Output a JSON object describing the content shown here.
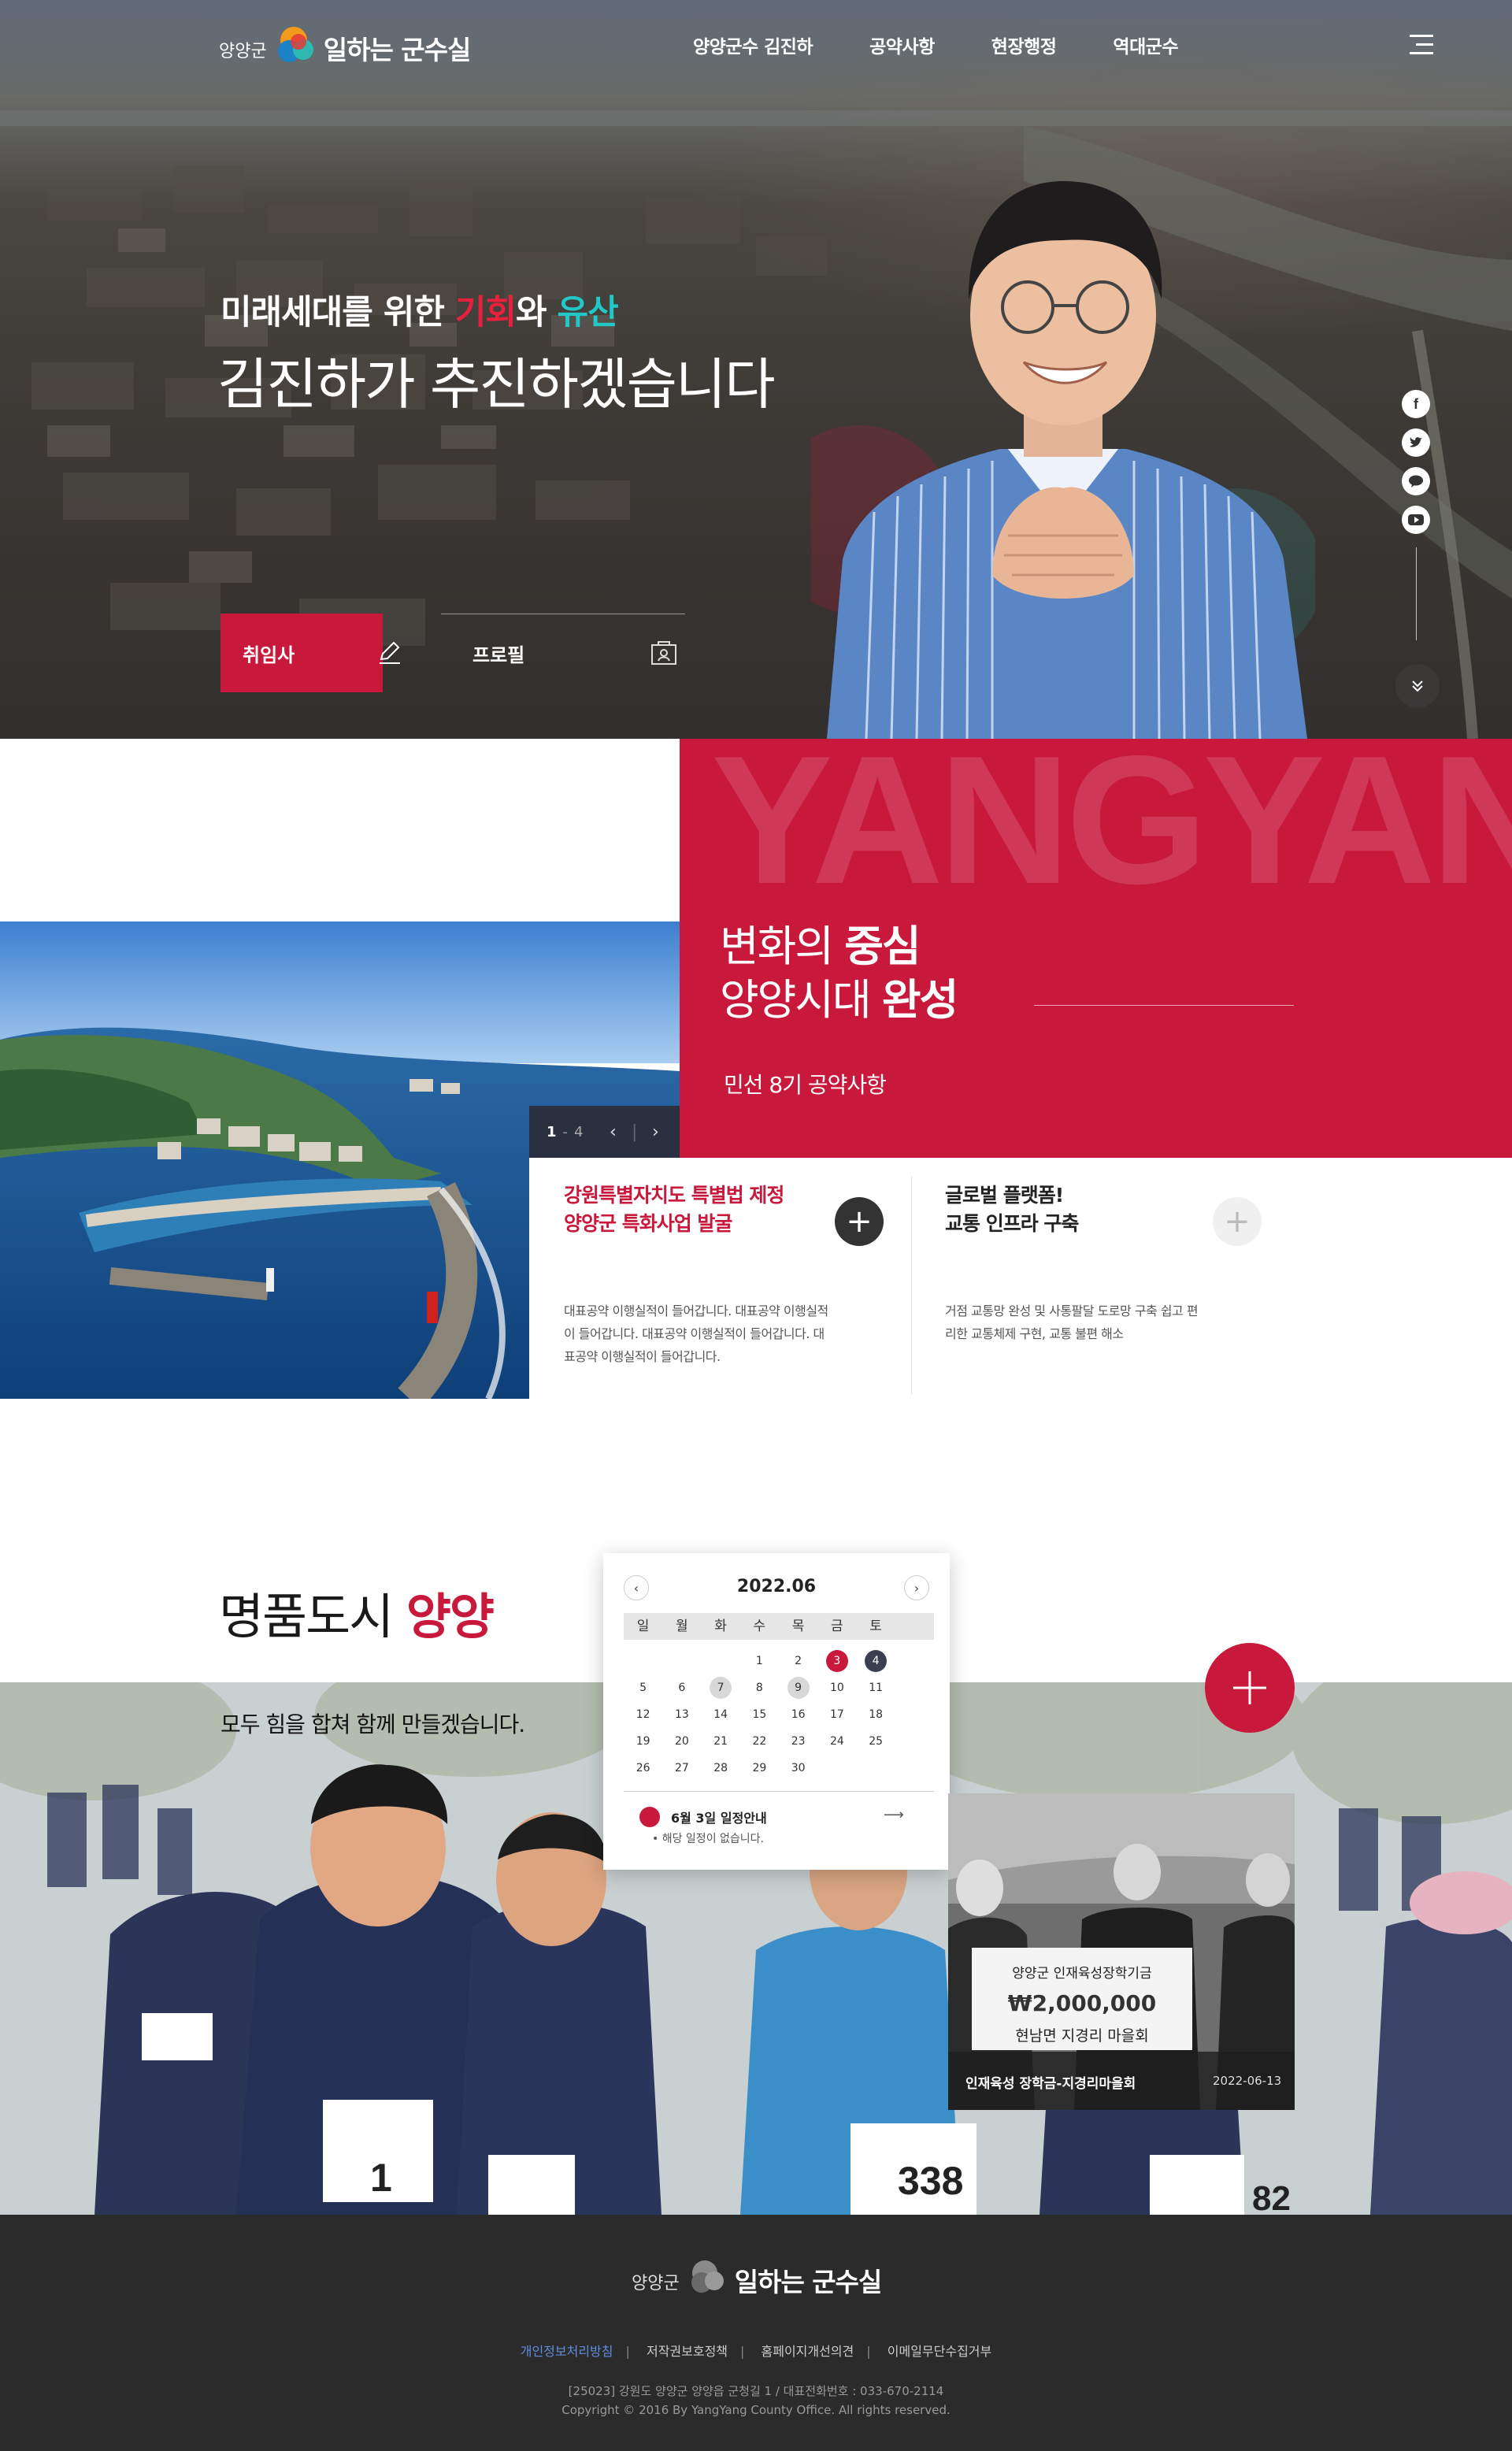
{
  "header": {
    "logo_small": "양양군",
    "logo_big": "일하는 군수실",
    "menu": [
      "양양군수 김진하",
      "공약사항",
      "현장행정",
      "역대군수"
    ]
  },
  "hero": {
    "sub_part1": "미래세대를 위한 ",
    "sub_red": "기회",
    "sub_part2": "와 ",
    "sub_cyan": "유산",
    "title": "김진하가 추진하겠습니다",
    "btn_inaug": "취임사",
    "btn_profile": "프로필",
    "social_icons": [
      "facebook-icon",
      "twitter-icon",
      "talk-icon",
      "youtube-icon"
    ]
  },
  "pledge": {
    "bg_text": "YANGYANG",
    "title_line1_a": "변화의 ",
    "title_line1_b": "중심",
    "title_line2_a": "양양시대 ",
    "title_line2_b": "완성",
    "subtitle": "민선 8기 공약사항",
    "pager_current": "1",
    "pager_total": "4",
    "cards": [
      {
        "title_line1": "강원특별자치도 특별법 제정",
        "title_line2": "양양군 특화사업 발굴",
        "desc": "대표공약 이행실적이 들어갑니다. 대표공약 이행실적이 들어갑니다. 대표공약 이행실적이 들어갑니다. 대표공약 이행실적이 들어갑니다."
      },
      {
        "title_line1": "글로벌 플랫폼!",
        "title_line2": "교통 인프라 구축",
        "desc": "거점 교통망 완성 및 사통팔달 도로망 구축 쉽고 편리한 교통체제 구현, 교통 불편 해소"
      }
    ]
  },
  "city": {
    "title_a": "명품도시 ",
    "title_b": "양양",
    "subtitle": "모두 힘을 합쳐 함께 만들겠습니다."
  },
  "calendar": {
    "month": "2022.06",
    "weekdays": [
      "일",
      "월",
      "화",
      "수",
      "목",
      "금",
      "토"
    ],
    "weeks": [
      [
        "",
        "",
        "",
        "1",
        "2",
        "3",
        "4"
      ],
      [
        "5",
        "6",
        "7",
        "8",
        "9",
        "10",
        "11"
      ],
      [
        "12",
        "13",
        "14",
        "15",
        "16",
        "17",
        "18"
      ],
      [
        "19",
        "20",
        "21",
        "22",
        "23",
        "24",
        "25"
      ],
      [
        "26",
        "27",
        "28",
        "29",
        "30",
        "",
        ""
      ]
    ],
    "event_title": "6월 3일 일정안내",
    "event_note": "해당 일정이 없습니다."
  },
  "news": {
    "board_title": "양양군 인재육성장학기금",
    "board_amount": "₩2,000,000",
    "board_from": "현남면 지경리 마을회",
    "caption": "인재육성 장학금-지경리마을회",
    "date": "2022-06-13"
  },
  "footer": {
    "logo_small": "양양군",
    "logo_big": "일하는 군수실",
    "links": [
      "개인정보처리방침",
      "저작권보호정책",
      "홈페이지개선의견",
      "이메일무단수집거부"
    ],
    "address": "[25023] 강원도 양양군 양양읍 군청길 1 / 대표전화번호 : 033-670-2114",
    "copyright": "Copyright © 2016 By YangYang County Office. All rights reserved."
  },
  "colors": {
    "brand_red": "#c8193c",
    "dark_navy": "#2a3040",
    "footer_bg": "#2b2b2b"
  }
}
